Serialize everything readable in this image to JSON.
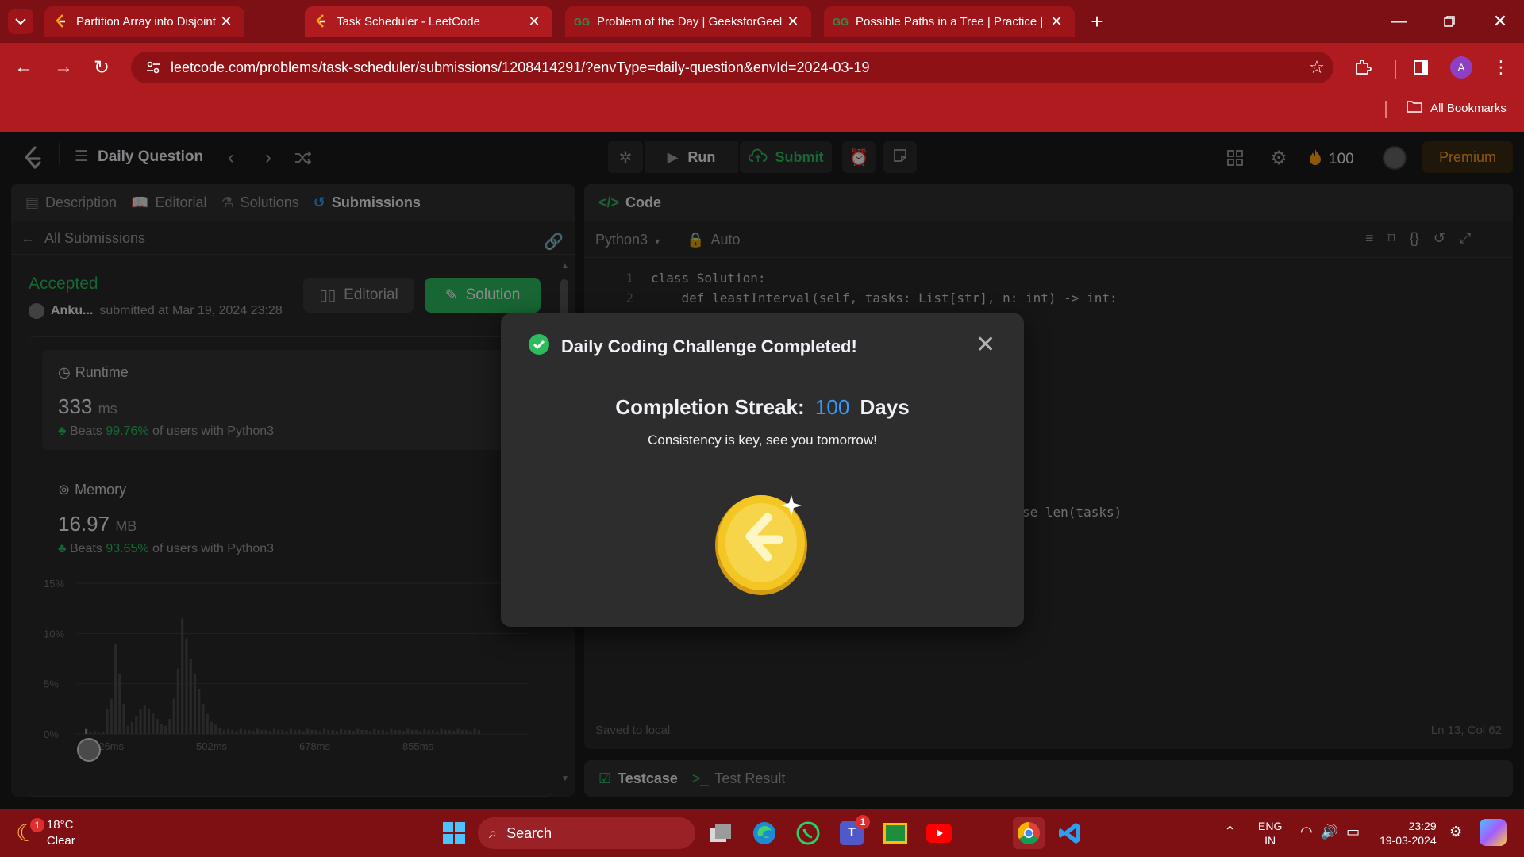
{
  "browser": {
    "tabs": [
      {
        "title": "Partition Array into Disjoint Interva",
        "active": false
      },
      {
        "title": "Task Scheduler - LeetCode",
        "active": true
      },
      {
        "title": "Problem of the Day | GeeksforGeel",
        "active": false
      },
      {
        "title": "Possible Paths in a Tree | Practice |",
        "active": false
      }
    ],
    "url": "leetcode.com/problems/task-scheduler/submissions/1208414291/?envType=daily-question&envId=2024-03-19",
    "profile_initial": "A",
    "bookmarks_label": "All Bookmarks"
  },
  "header": {
    "daily_question": "Daily Question",
    "run": "Run",
    "submit": "Submit",
    "streak_count": "100",
    "premium": "Premium"
  },
  "left_panel": {
    "tabs": [
      "Description",
      "Editorial",
      "Solutions",
      "Submissions"
    ],
    "all_submissions": "All Submissions",
    "status": "Accepted",
    "author": "Anku...",
    "submitted_at": "submitted at Mar 19, 2024 23:28",
    "editorial_btn": "Editorial",
    "solution_btn": "Solution",
    "runtime": {
      "label": "Runtime",
      "value": "333",
      "unit": "ms",
      "beats_prefix": "Beats",
      "beats_pct": "99.76%",
      "beats_suffix": "of users with Python3"
    },
    "memory": {
      "label": "Memory",
      "value": "16.97",
      "unit": "MB",
      "beats_prefix": "Beats",
      "beats_pct": "93.65%",
      "beats_suffix": "of users with Python3"
    }
  },
  "chart_data": {
    "type": "bar",
    "y_ticks": [
      "15%",
      "10%",
      "5%",
      "0%"
    ],
    "x_ticks": [
      "326ms",
      "502ms",
      "678ms",
      "855ms"
    ],
    "ylim": [
      0,
      15
    ],
    "values": [
      0.5,
      0.2,
      0.3,
      0.1,
      0.2,
      2.5,
      3.5,
      9.0,
      6.0,
      3.0,
      0.8,
      1.2,
      1.8,
      2.5,
      2.8,
      2.5,
      2.0,
      1.5,
      1.0,
      0.8,
      1.5,
      3.5,
      6.5,
      11.5,
      9.5,
      7.5,
      6.0,
      4.5,
      3.0,
      2.0,
      1.2,
      0.9,
      0.6,
      0.4,
      0.5,
      0.4,
      0.3,
      0.5,
      0.4,
      0.4,
      0.3,
      0.5,
      0.4,
      0.4,
      0.3,
      0.5,
      0.4,
      0.4,
      0.3,
      0.5,
      0.4,
      0.4,
      0.3,
      0.5,
      0.4,
      0.4,
      0.3,
      0.5,
      0.4,
      0.4,
      0.3,
      0.5,
      0.4,
      0.4,
      0.3,
      0.5,
      0.4,
      0.4,
      0.3,
      0.5,
      0.4,
      0.4,
      0.3,
      0.5,
      0.4,
      0.4,
      0.3,
      0.5,
      0.4,
      0.4,
      0.3,
      0.5,
      0.4,
      0.4,
      0.3,
      0.5,
      0.4,
      0.4,
      0.3,
      0.5,
      0.4,
      0.4,
      0.3,
      0.5,
      0.4
    ]
  },
  "code_panel": {
    "title": "Code",
    "language": "Python3",
    "mode": "Auto",
    "lines": [
      {
        "n": "1",
        "text": "class Solution:"
      },
      {
        "n": "2",
        "text": "    def leastInterval(self, tasks: List[str], n: int) -> int:"
      }
    ],
    "partial_line": "se len(tasks)",
    "saved": "Saved to local",
    "cursor": "Ln 13, Col 62"
  },
  "bottom_panel": {
    "testcase": "Testcase",
    "test_result": "Test Result"
  },
  "modal": {
    "title": "Daily Coding Challenge Completed!",
    "streak_label": "Completion Streak:",
    "streak_value": "100",
    "streak_unit": "Days",
    "message": "Consistency is key, see you tomorrow!"
  },
  "taskbar": {
    "weather_badge": "1",
    "temperature": "18°C",
    "condition": "Clear",
    "search": "Search",
    "teams_badge": "1",
    "lang_top": "ENG",
    "lang_bottom": "IN",
    "time": "23:29",
    "date": "19-03-2024"
  },
  "colors": {
    "accepted": "#2cbb5d",
    "accent_blue": "#3b99f5",
    "brand_orange": "#ffa116"
  }
}
